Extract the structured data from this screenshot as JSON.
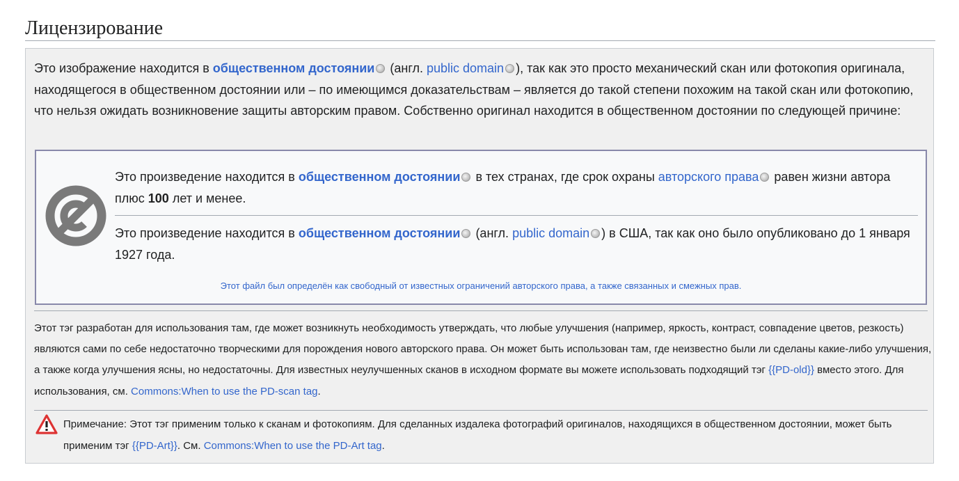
{
  "heading": "Лицензирование",
  "intro": {
    "t1": "Это изображение находится в ",
    "link_pd": "общественном достоянии",
    "t2": " (англ. ",
    "link_pd_en": "public domain",
    "t3": "), так как это просто механический скан или фотокопия оригинала, находящегося в общественном достоянии или – по имеющимся доказательствам – является до такой степени похожим на такой скан или фотокопию, что нельзя ожидать возникновение защиты авторским правом. Собственно оригинал находится в общественном достоянии по следующей причине:"
  },
  "clause1": {
    "t1": "Это произведение находится в ",
    "link_pd": "общественном достоянии",
    "t2": " в тех странах, где срок охраны ",
    "link_copyright": "авторского права",
    "t3": " равен жизни автора плюс ",
    "years": "100",
    "t4": " лет и менее."
  },
  "clause2": {
    "t1": "Это произведение находится в ",
    "link_pd": "общественном достоянии",
    "t2": " (англ. ",
    "link_pd_en": "public domain",
    "t3": ") в США, так как оно было опубликовано до 1 января 1927 года."
  },
  "free_note": "Этот файл был определён как свободный от известных ограничений авторского права, а также связанных и смежных прав.",
  "tag_text": {
    "t1": "Этот тэг разработан для использования там, где может возникнуть необходимость утверждать, что любые улучшения (например, яркость, контраст, совпадение цветов, резкость) являются сами по себе недостаточно творческими для порождения нового авторского права. Он может быть использован там, где неизвестно были ли сделаны какие-либо улучшения, а также когда улучшения ясны, но недостаточны. Для известных неулучшенных сканов в исходном формате вы можете использовать подходящий тэг ",
    "link_pd_old": "{{PD-old}}",
    "t2": " вместо этого. Для использования, см. ",
    "link_when_scan": "Commons:When to use the PD-scan tag",
    "t3": "."
  },
  "note_text": {
    "t1": "Примечание: Этот тэг применим только к сканам и фотокопиям. Для сделанных издалека фотографий оригиналов, находящихся в общественном достоянии, может быть применим тэг ",
    "link_pd_art": "{{PD-Art}}",
    "t2": ". См. ",
    "link_when_art": "Commons:When to use the PD-Art tag",
    "t3": "."
  },
  "icons": {
    "pd_logo": "public-domain-icon",
    "wikipedia": "wikipedia-globe-icon",
    "warning": "warning-icon"
  },
  "colors": {
    "link": "#3366cc",
    "box_bg": "#f0f0f0",
    "inner_bg": "#f8f9fa",
    "inner_border": "#8888aa",
    "warning": "#d33"
  }
}
